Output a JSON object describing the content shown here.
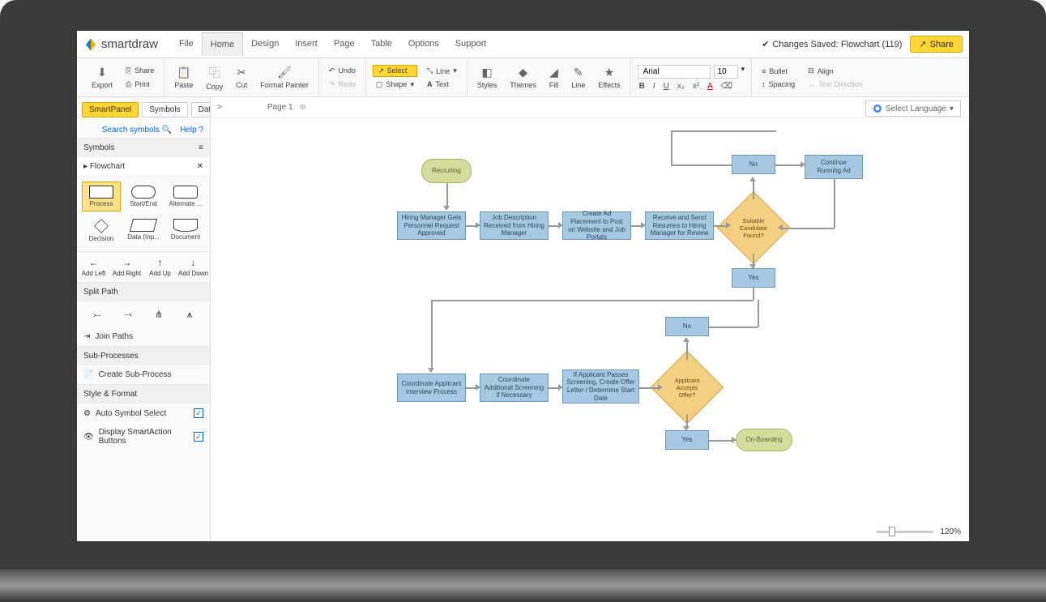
{
  "app": {
    "brand": "smartdraw"
  },
  "menu": {
    "items": [
      "File",
      "Home",
      "Design",
      "Insert",
      "Page",
      "Table",
      "Options",
      "Support"
    ],
    "active": "Home"
  },
  "status": {
    "saved": "Changes Saved: Flowchart (119)",
    "share": "Share"
  },
  "toolbar": {
    "export": "Export",
    "share": "Share",
    "print": "Print",
    "paste": "Paste",
    "copy": "Copy",
    "cut": "Cut",
    "fmtpainter": "Format Painter",
    "undo": "Undo",
    "redo": "Redo",
    "select": "Select",
    "shape": "Shape",
    "linetool": "Line",
    "text": "Text",
    "styles": "Styles",
    "themes": "Themes",
    "fill": "Fill",
    "linebtn": "Line",
    "effects": "Effects",
    "font": "Arial",
    "fontsize": "10",
    "bullet": "Bullet",
    "align": "Align",
    "spacing": "Spacing",
    "textdir": "Text Direction"
  },
  "panel": {
    "tabs": [
      "SmartPanel",
      "Symbols",
      "Data"
    ],
    "search": "Search symbols",
    "help": "Help",
    "symheader": "Symbols",
    "symsub": "Flowchart",
    "shapes": [
      "Process",
      "Start/End",
      "Alternate ...",
      "Decision",
      "Data (Inp...",
      "Document"
    ],
    "add": {
      "left": "Add Left",
      "right": "Add Right",
      "up": "Add Up",
      "down": "Add Down"
    },
    "split": "Split Path",
    "join": "Join Paths",
    "sub": "Sub-Processes",
    "create_sub": "Create Sub-Process",
    "style": "Style & Format",
    "auto": "Auto Symbol Select",
    "smartaction": "Display SmartAction Buttons"
  },
  "page": {
    "tab": "Page 1",
    "lang": "Select Language",
    "zoom": "120%"
  },
  "flow": {
    "recruit": "Recruiting",
    "r1c1": "Hiring Manager Gets Personnel Request Approved",
    "r1c2": "Job Description Received from Hiring Manager",
    "r1c3": "Create Ad Placement to Post on Website and Job Portals",
    "r1c4": "Receive and Send Resumes to Hiring Manager for Review",
    "d1": "Suitable Candidate Found?",
    "no1": "No",
    "yes1": "Yes",
    "contad": "Continue Running Ad",
    "r2c1": "Coordinate Applicant Interview Process",
    "r2c2": "Coordinate Additional Screening if Necessary",
    "r2c3": "If Applicant Passes Screening, Create Offer Letter / Determine Start Date",
    "d2": "Applicant Accepts Offer?",
    "no2": "No",
    "yes2": "Yes",
    "onboard": "On-Boarding"
  }
}
